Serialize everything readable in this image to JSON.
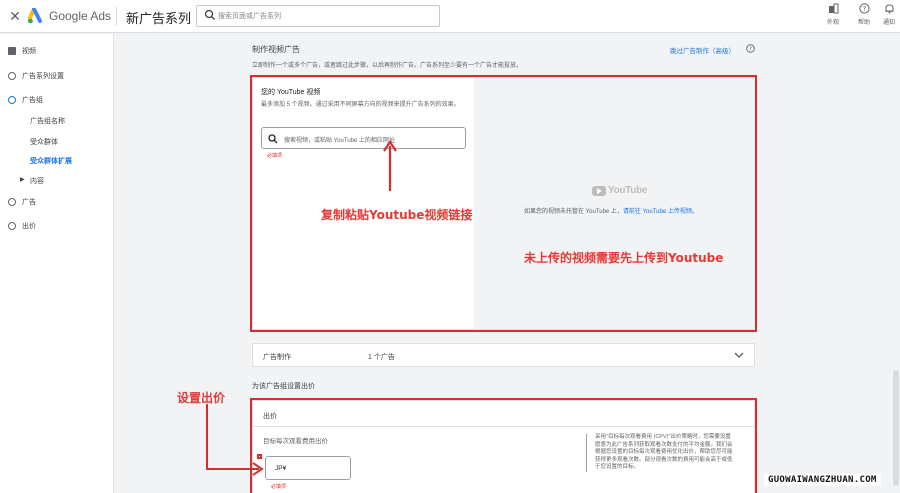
{
  "topbar": {
    "close_icon": "close-icon",
    "product_name": "Google Ads",
    "page_title": "新广告系列",
    "search_placeholder": "搜索页面或广告系列",
    "actions": [
      {
        "icon": "appearance-icon",
        "label": "外观"
      },
      {
        "icon": "help-icon",
        "label": "帮助"
      },
      {
        "icon": "bell-icon",
        "label": "通知"
      }
    ]
  },
  "sidebar": {
    "items": [
      {
        "label": "视频",
        "state": "done"
      },
      {
        "label": "广告系列设置",
        "state": "pending"
      },
      {
        "label": "广告组",
        "state": "current"
      },
      {
        "label": "广告",
        "state": "pending"
      },
      {
        "label": "出价",
        "state": "pending"
      }
    ],
    "subitems": [
      "广告组名称",
      "受众群体",
      "受众群体扩展"
    ],
    "active_subitem": "受众群体扩展",
    "collapsible": "内容"
  },
  "main": {
    "section_title": "制作视频广告",
    "section_desc": "立即制作一个或多个广告，或者跳过此步骤，以后再制作广告。广告系列至少要有一个广告才能投放。",
    "skip_link": "跳过广告制作（高级）",
    "youtube": {
      "title": "您的 YouTube 视频",
      "desc": "最多添加 5 个视频。通过采用不同屏幕方向的视频来提升广告系列的效果。",
      "search_placeholder": "搜索视频，或粘贴 YouTube 上的相应网址",
      "required": "必填项",
      "logo_text": "YouTube",
      "note": "如果您的视频未托管在 YouTube 上，",
      "note_link": "请前往 YouTube 上传视频。"
    },
    "ad_creation": {
      "label": "广告制作",
      "value": "1 个广告"
    },
    "bid_section_title": "为该广告组设置出价",
    "bid": {
      "header": "出价",
      "field_label": "目标每次观看费用出价",
      "currency_value": "JP¥",
      "required": "必填项",
      "help": "采用\"目标每次观看费用 (CPV)\"出价策略时，您需要设置愿意为此广告系列获取观看次数支付的平均金额。我们会根据您设置的目标每次观看费用优化出价，帮助您尽可能获得更多观看次数。部分观看次数的费用可能会高于或低于您设置的目标。"
    }
  },
  "annotations": {
    "copy_paste": "复制粘贴Youtube视频链接",
    "upload_first": "未上传的视频需要先上传到Youtube",
    "set_bid": "设置出价",
    "color": "#e53935"
  },
  "watermark": "GUOWAIWANGZHUAN.COM"
}
